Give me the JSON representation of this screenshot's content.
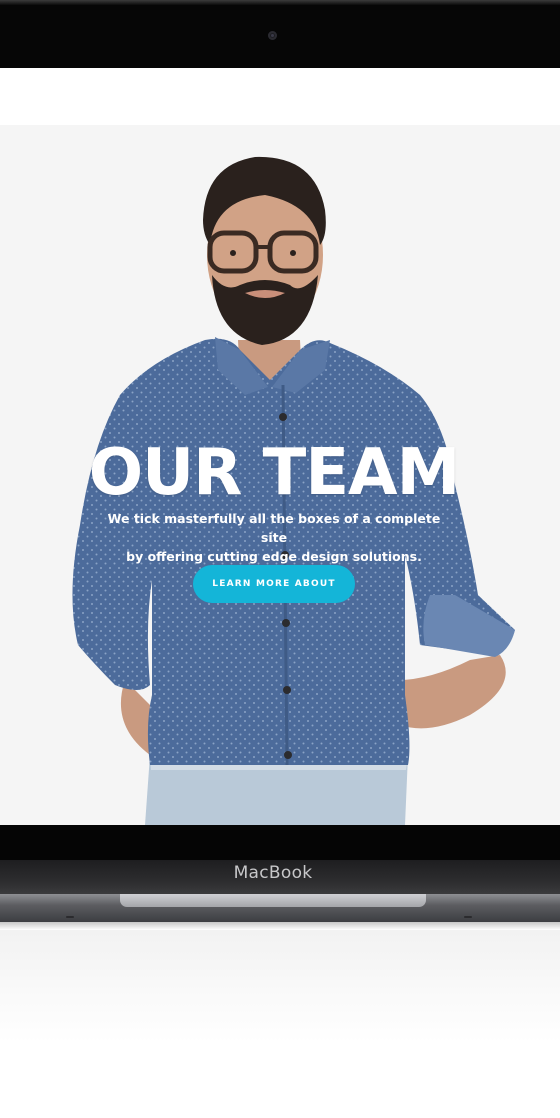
{
  "hero": {
    "title": "OUR TEAM",
    "subtitle_line1": "We tick masterfully all the boxes of a complete site",
    "subtitle_line2": "by offering cutting edge design solutions.",
    "cta_label": "LEARN MORE ABOUT"
  },
  "device": {
    "brand": "MacBook"
  },
  "colors": {
    "accent": "#14b5d8",
    "shirt": "#4a6a9a",
    "screen_bg": "#f4f4f4",
    "bezel": "#060606"
  },
  "icons": {
    "camera": "webcam-icon"
  }
}
